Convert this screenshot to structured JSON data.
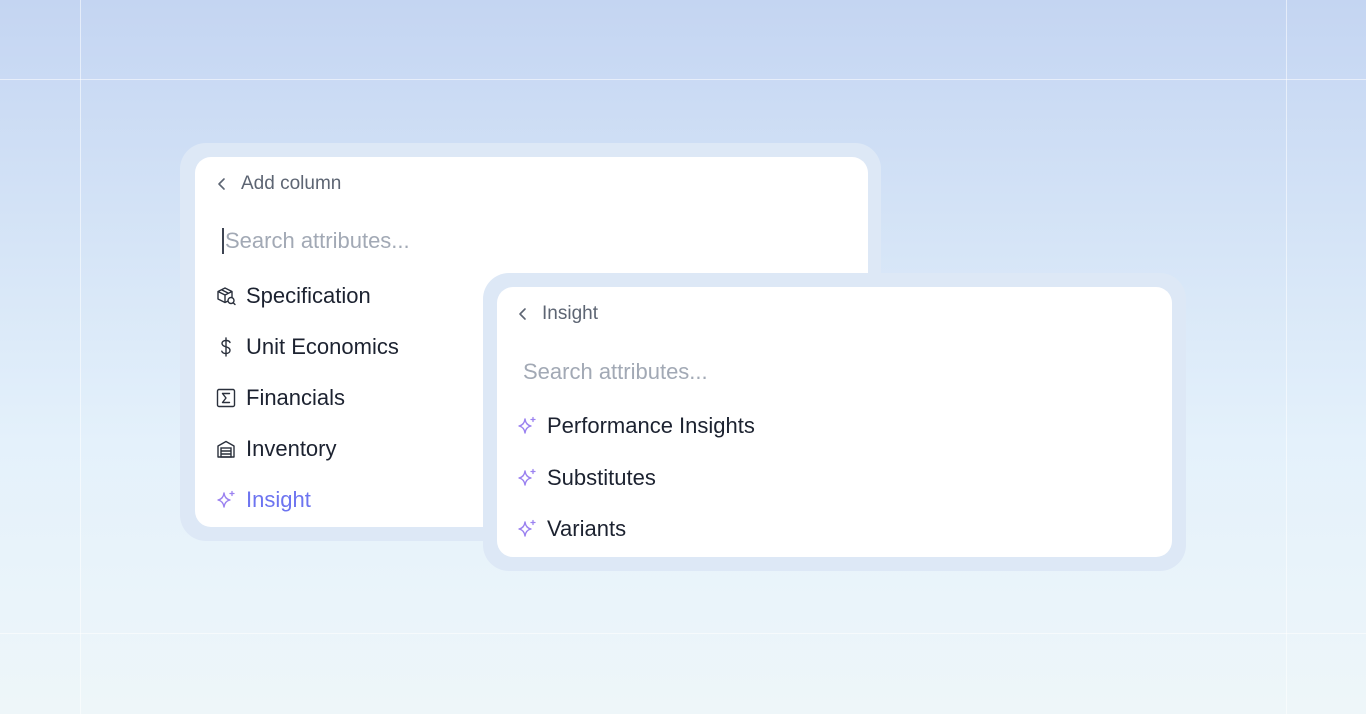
{
  "colors": {
    "accent": "#6d74f0",
    "sparkle": "#9b82f0",
    "text": "#1c2230",
    "muted": "#5d6573",
    "placeholder": "#a2a9b5",
    "panel_frame": "#dde8f6",
    "panel_bg": "#ffffff"
  },
  "panel_add_column": {
    "back_icon": "chevron-left-icon",
    "title": "Add column",
    "search_placeholder": "Search attributes...",
    "items": [
      {
        "label": "Specification",
        "icon": "package-search-icon"
      },
      {
        "label": "Unit Economics",
        "icon": "dollar-icon"
      },
      {
        "label": "Financials",
        "icon": "sigma-icon"
      },
      {
        "label": "Inventory",
        "icon": "warehouse-icon"
      },
      {
        "label": "Insight",
        "icon": "sparkle-icon",
        "active": true
      }
    ]
  },
  "panel_insight": {
    "back_icon": "chevron-left-icon",
    "title": "Insight",
    "search_placeholder": "Search attributes...",
    "items": [
      {
        "label": "Performance Insights",
        "icon": "sparkle-icon"
      },
      {
        "label": "Substitutes",
        "icon": "sparkle-icon"
      },
      {
        "label": "Variants",
        "icon": "sparkle-icon"
      }
    ]
  }
}
